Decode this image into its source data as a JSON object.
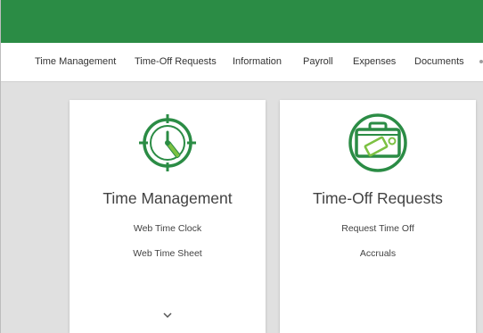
{
  "colors": {
    "header_green": "#2b8c45",
    "icon_green": "#2b8c45",
    "icon_light_green": "#7cc142",
    "content_bg": "#e0e0e0"
  },
  "nav": {
    "items": [
      {
        "label": "Time Management"
      },
      {
        "label": "Time-Off Requests"
      },
      {
        "label": "Information"
      },
      {
        "label": "Payroll"
      },
      {
        "label": "Expenses"
      },
      {
        "label": "Documents"
      }
    ]
  },
  "cards": [
    {
      "title": "Time Management",
      "icon": "clock-icon",
      "links": [
        "Web Time Clock",
        "Web Time Sheet"
      ],
      "expand_icon": "chevron-down-icon"
    },
    {
      "title": "Time-Off Requests",
      "icon": "suitcase-icon",
      "links": [
        "Request Time Off",
        "Accruals"
      ]
    }
  ]
}
